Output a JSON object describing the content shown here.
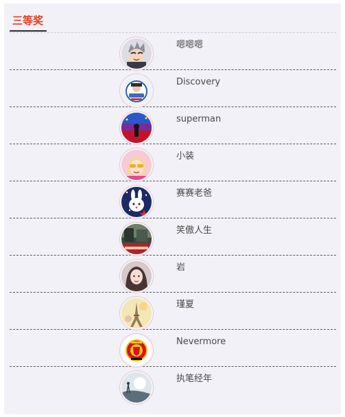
{
  "section": {
    "title": "三等奖",
    "accent_color": "#e8391d"
  },
  "winners": [
    {
      "name": "嗯嗯嗯",
      "avatar_icon": "cartoon-character-avatar-icon"
    },
    {
      "name": "Discovery",
      "avatar_icon": "badge-emblem-avatar-icon"
    },
    {
      "name": "superman",
      "avatar_icon": "night-concert-avatar-icon"
    },
    {
      "name": "小装",
      "avatar_icon": "girl-sunglasses-avatar-icon"
    },
    {
      "name": "赛赛老爸",
      "avatar_icon": "white-rabbit-avatar-icon"
    },
    {
      "name": "笑傲人生",
      "avatar_icon": "china-jiayou-avatar-icon"
    },
    {
      "name": "岩",
      "avatar_icon": "woman-portrait-avatar-icon"
    },
    {
      "name": "瑾夏",
      "avatar_icon": "eiffel-tower-avatar-icon"
    },
    {
      "name": "Nevermore",
      "avatar_icon": "football-club-crest-avatar-icon"
    },
    {
      "name": "执笔经年",
      "avatar_icon": "moon-silhouette-avatar-icon"
    }
  ]
}
